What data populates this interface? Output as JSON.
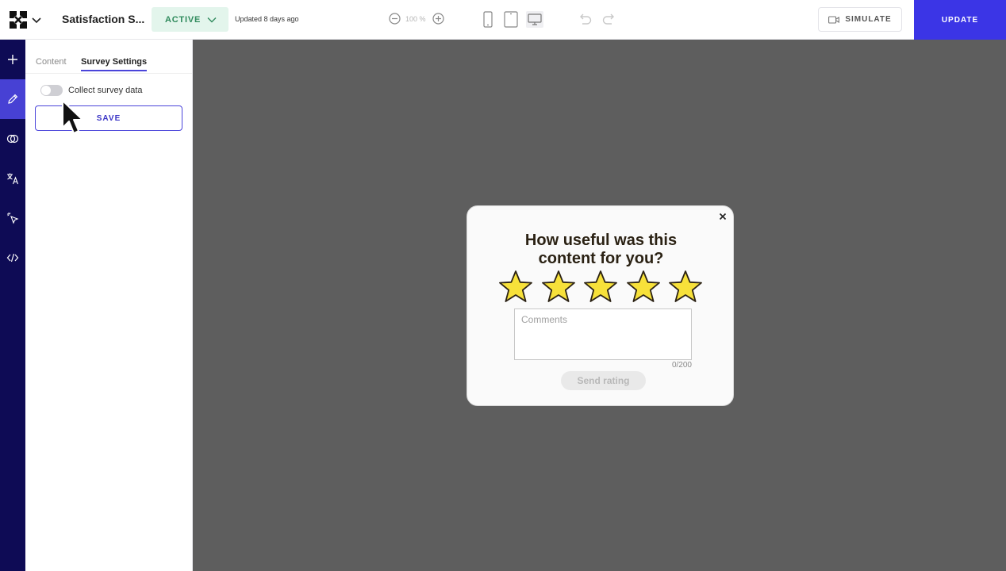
{
  "header": {
    "title": "Satisfaction S...",
    "status": "ACTIVE",
    "updated": "Updated 8 days ago",
    "zoom": "100 %",
    "simulate_label": "SIMULATE",
    "update_label": "UPDATE"
  },
  "sidebar_nav": {
    "items": [
      "plus-icon",
      "pencil-icon",
      "overlap-circles-icon",
      "translate-icon",
      "click-cursor-icon",
      "code-icon"
    ],
    "active": "pencil-icon"
  },
  "panel": {
    "tabs": [
      {
        "label": "Content",
        "active": false
      },
      {
        "label": "Survey Settings",
        "active": true
      }
    ],
    "toggle_label": "Collect survey data",
    "toggle_on": false,
    "save_label": "SAVE"
  },
  "popup": {
    "title": "How useful was this content for you?",
    "stars": 5,
    "comments_placeholder": "Comments",
    "counter": "0/200",
    "send_label": "Send rating"
  },
  "colors": {
    "accent": "#3b35e6",
    "nav_bg": "#0e0b55",
    "active_pill_bg": "#e3f5ec",
    "active_pill_text": "#2f8a5c",
    "star_fill": "#f7e13a",
    "canvas_bg": "#5e5e5e"
  }
}
